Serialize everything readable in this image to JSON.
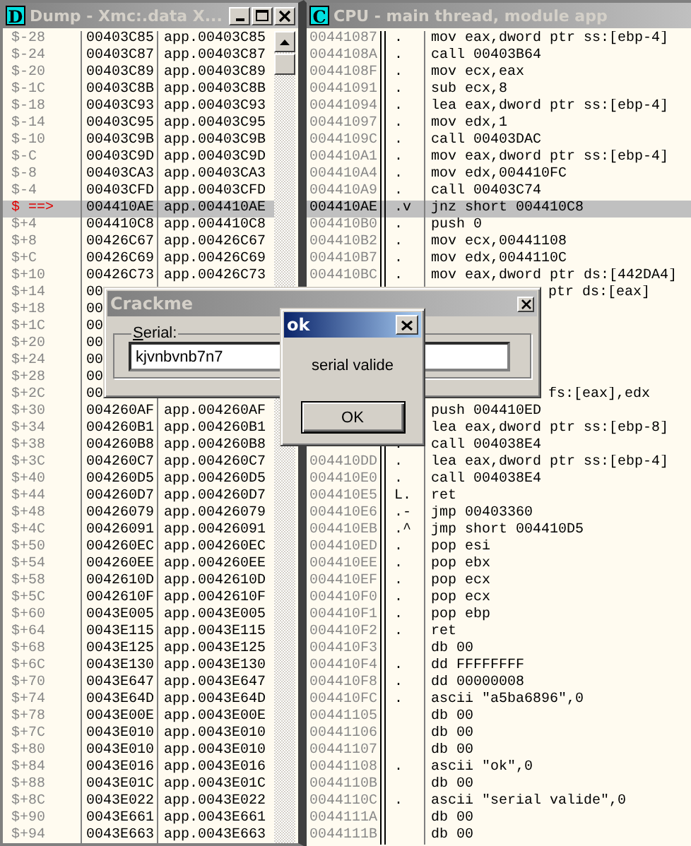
{
  "dump": {
    "icon": "D",
    "title": "Dump - Xmc:.data X...",
    "rows": [
      {
        "offset": "$-28",
        "address": "00403C85",
        "value": "app.00403C85",
        "selected": false
      },
      {
        "offset": "$-24",
        "address": "00403C87",
        "value": "app.00403C87",
        "selected": false
      },
      {
        "offset": "$-20",
        "address": "00403C89",
        "value": "app.00403C89",
        "selected": false
      },
      {
        "offset": "$-1C",
        "address": "00403C8B",
        "value": "app.00403C8B",
        "selected": false
      },
      {
        "offset": "$-18",
        "address": "00403C93",
        "value": "app.00403C93",
        "selected": false
      },
      {
        "offset": "$-14",
        "address": "00403C95",
        "value": "app.00403C95",
        "selected": false
      },
      {
        "offset": "$-10",
        "address": "00403C9B",
        "value": "app.00403C9B",
        "selected": false
      },
      {
        "offset": "$-C",
        "address": "00403C9D",
        "value": "app.00403C9D",
        "selected": false
      },
      {
        "offset": "$-8",
        "address": "00403CA3",
        "value": "app.00403CA3",
        "selected": false
      },
      {
        "offset": "$-4",
        "address": "00403CFD",
        "value": "app.00403CFD",
        "selected": false
      },
      {
        "offset": "$ ==>",
        "address": "004410AE",
        "value": "app.004410AE",
        "selected": true
      },
      {
        "offset": "$+4",
        "address": "004410C8",
        "value": "app.004410C8",
        "selected": false
      },
      {
        "offset": "$+8",
        "address": "00426C67",
        "value": "app.00426C67",
        "selected": false
      },
      {
        "offset": "$+C",
        "address": "00426C69",
        "value": "app.00426C69",
        "selected": false
      },
      {
        "offset": "$+10",
        "address": "00426C73",
        "value": "app.00426C73",
        "selected": false
      },
      {
        "offset": "$+14",
        "address": "00",
        "selected": false
      },
      {
        "offset": "$+18",
        "address": "00",
        "selected": false
      },
      {
        "offset": "$+1C",
        "address": "00",
        "selected": false
      },
      {
        "offset": "$+20",
        "address": "00",
        "selected": false
      },
      {
        "offset": "$+24",
        "address": "00",
        "selected": false
      },
      {
        "offset": "$+28",
        "address": "00",
        "selected": false
      },
      {
        "offset": "$+2C",
        "address": "00",
        "selected": false
      },
      {
        "offset": "$+30",
        "address": "004260AF",
        "value": "app.004260AF",
        "selected": false
      },
      {
        "offset": "$+34",
        "address": "004260B1",
        "value": "app.004260B1",
        "selected": false
      },
      {
        "offset": "$+38",
        "address": "004260B8",
        "value": "app.004260B8",
        "selected": false
      },
      {
        "offset": "$+3C",
        "address": "004260C7",
        "value": "app.004260C7",
        "selected": false
      },
      {
        "offset": "$+40",
        "address": "004260D5",
        "value": "app.004260D5",
        "selected": false
      },
      {
        "offset": "$+44",
        "address": "004260D7",
        "value": "app.004260D7",
        "selected": false
      },
      {
        "offset": "$+48",
        "address": "00426079",
        "value": "app.00426079",
        "selected": false
      },
      {
        "offset": "$+4C",
        "address": "00426091",
        "value": "app.00426091",
        "selected": false
      },
      {
        "offset": "$+50",
        "address": "004260EC",
        "value": "app.004260EC",
        "selected": false
      },
      {
        "offset": "$+54",
        "address": "004260EE",
        "value": "app.004260EE",
        "selected": false
      },
      {
        "offset": "$+58",
        "address": "0042610D",
        "value": "app.0042610D",
        "selected": false
      },
      {
        "offset": "$+5C",
        "address": "0042610F",
        "value": "app.0042610F",
        "selected": false
      },
      {
        "offset": "$+60",
        "address": "0043E005",
        "value": "app.0043E005",
        "selected": false
      },
      {
        "offset": "$+64",
        "address": "0043E115",
        "value": "app.0043E115",
        "selected": false
      },
      {
        "offset": "$+68",
        "address": "0043E125",
        "value": "app.0043E125",
        "selected": false
      },
      {
        "offset": "$+6C",
        "address": "0043E130",
        "value": "app.0043E130",
        "selected": false
      },
      {
        "offset": "$+70",
        "address": "0043E647",
        "value": "app.0043E647",
        "selected": false
      },
      {
        "offset": "$+74",
        "address": "0043E64D",
        "value": "app.0043E64D",
        "selected": false
      },
      {
        "offset": "$+78",
        "address": "0043E00E",
        "value": "app.0043E00E",
        "selected": false
      },
      {
        "offset": "$+7C",
        "address": "0043E010",
        "value": "app.0043E010",
        "selected": false
      },
      {
        "offset": "$+80",
        "address": "0043E010",
        "value": "app.0043E010",
        "selected": false
      },
      {
        "offset": "$+84",
        "address": "0043E016",
        "value": "app.0043E016",
        "selected": false
      },
      {
        "offset": "$+88",
        "address": "0043E01C",
        "value": "app.0043E01C",
        "selected": false
      },
      {
        "offset": "$+8C",
        "address": "0043E022",
        "value": "app.0043E022",
        "selected": false
      },
      {
        "offset": "$+90",
        "address": "0043E661",
        "value": "app.0043E661",
        "selected": false
      },
      {
        "offset": "$+94",
        "address": "0043E663",
        "value": "app.0043E663",
        "selected": false
      }
    ]
  },
  "cpu": {
    "icon": "C",
    "title": "CPU - main thread, module app",
    "rows": [
      {
        "kind": "full",
        "address": "00441087",
        "mark": ".",
        "code": "mov eax,dword ptr ss:[ebp-4]",
        "selected": false
      },
      {
        "kind": "full",
        "address": "0044108A",
        "mark": ".",
        "code": "call 00403B64",
        "selected": false
      },
      {
        "kind": "full",
        "address": "0044108F",
        "mark": ".",
        "code": "mov ecx,eax",
        "selected": false
      },
      {
        "kind": "full",
        "address": "00441091",
        "mark": ".",
        "code": "sub ecx,8",
        "selected": false
      },
      {
        "kind": "full",
        "address": "00441094",
        "mark": ".",
        "code": "lea eax,dword ptr ss:[ebp-4]",
        "selected": false
      },
      {
        "kind": "full",
        "address": "00441097",
        "mark": ".",
        "code": "mov edx,1",
        "selected": false
      },
      {
        "kind": "full",
        "address": "0044109C",
        "mark": ".",
        "code": "call 00403DAC",
        "selected": false
      },
      {
        "kind": "full",
        "address": "004410A1",
        "mark": ".",
        "code": "mov eax,dword ptr ss:[ebp-4]",
        "selected": false
      },
      {
        "kind": "full",
        "address": "004410A4",
        "mark": ".",
        "code": "mov edx,004410FC",
        "selected": false
      },
      {
        "kind": "full",
        "address": "004410A9",
        "mark": ".",
        "code": "call 00403C74",
        "selected": false
      },
      {
        "kind": "full",
        "address": "004410AE",
        "mark": ".v",
        "code": "jnz short 004410C8",
        "selected": true
      },
      {
        "kind": "full",
        "address": "004410B0",
        "mark": ".",
        "code": "push 0",
        "selected": false
      },
      {
        "kind": "full",
        "address": "004410B2",
        "mark": ".",
        "code": "mov ecx,00441108",
        "selected": false
      },
      {
        "kind": "full",
        "address": "004410B7",
        "mark": ".",
        "code": "mov edx,0044110C",
        "selected": false
      },
      {
        "kind": "full",
        "address": "004410BC",
        "mark": ".",
        "code": "mov eax,dword ptr ds:[442DA4]",
        "selected": false
      },
      {
        "kind": "covered",
        "code": "ptr ds:[eax]"
      },
      {
        "kind": "covered"
      },
      {
        "kind": "covered"
      },
      {
        "kind": "covered"
      },
      {
        "kind": "covered"
      },
      {
        "kind": "covered"
      },
      {
        "kind": "covered",
        "code": "fs:[eax],edx"
      },
      {
        "kind": "full",
        "code": "push 004410ED",
        "selected": false
      },
      {
        "kind": "full",
        "code": "lea eax,dword ptr ss:[ebp-8]",
        "selected": false
      },
      {
        "kind": "full",
        "mark": ".",
        "code": "call 004038E4",
        "selected": false
      },
      {
        "kind": "full",
        "address": "004410DD",
        "mark": ".",
        "code": "lea eax,dword ptr ss:[ebp-4]",
        "selected": false
      },
      {
        "kind": "full",
        "address": "004410E0",
        "mark": ".",
        "code": "call 004038E4",
        "selected": false
      },
      {
        "kind": "full",
        "address": "004410E5",
        "mark": "L.",
        "code": "ret",
        "selected": false
      },
      {
        "kind": "full",
        "address": "004410E6",
        "mark": ".-",
        "code": "jmp 00403360",
        "selected": false
      },
      {
        "kind": "full",
        "address": "004410EB",
        "mark": ".^",
        "code": "jmp short 004410D5",
        "selected": false
      },
      {
        "kind": "full",
        "address": "004410ED",
        "mark": ".",
        "code": "pop esi",
        "selected": false
      },
      {
        "kind": "full",
        "address": "004410EE",
        "mark": ".",
        "code": "pop ebx",
        "selected": false
      },
      {
        "kind": "full",
        "address": "004410EF",
        "mark": ".",
        "code": "pop ecx",
        "selected": false
      },
      {
        "kind": "full",
        "address": "004410F0",
        "mark": ".",
        "code": "pop ecx",
        "selected": false
      },
      {
        "kind": "full",
        "address": "004410F1",
        "mark": ".",
        "code": "pop ebp",
        "selected": false
      },
      {
        "kind": "full",
        "address": "004410F2",
        "mark": ".",
        "code": "ret",
        "selected": false
      },
      {
        "kind": "full",
        "address": "004410F3",
        "code": "db 00",
        "selected": false
      },
      {
        "kind": "full",
        "address": "004410F4",
        "mark": ".",
        "code": "dd FFFFFFFF",
        "selected": false
      },
      {
        "kind": "full",
        "address": "004410F8",
        "mark": ".",
        "code": "dd 00000008",
        "selected": false
      },
      {
        "kind": "full",
        "address": "004410FC",
        "mark": ".",
        "code": "ascii \"a5ba6896\",0",
        "selected": false
      },
      {
        "kind": "full",
        "address": "00441105",
        "code": "db 00",
        "selected": false
      },
      {
        "kind": "full",
        "address": "00441106",
        "code": "db 00",
        "selected": false
      },
      {
        "kind": "full",
        "address": "00441107",
        "code": "db 00",
        "selected": false
      },
      {
        "kind": "full",
        "address": "00441108",
        "mark": ".",
        "code": "ascii \"ok\",0",
        "selected": false
      },
      {
        "kind": "full",
        "address": "0044110B",
        "code": "db 00",
        "selected": false
      },
      {
        "kind": "full",
        "address": "0044110C",
        "mark": ".",
        "code": "ascii \"serial valide\",0",
        "selected": false
      },
      {
        "kind": "full",
        "address": "0044111A",
        "code": "db 00",
        "selected": false
      },
      {
        "kind": "full",
        "address": "0044111B",
        "code": "db 00",
        "selected": false
      }
    ]
  },
  "crackme": {
    "title": "Crackme",
    "group_label": "Serial:",
    "serial_value": "kjvnbvnb7n7"
  },
  "message_box": {
    "title": "ok",
    "message": "serial valide",
    "button": "OK"
  }
}
